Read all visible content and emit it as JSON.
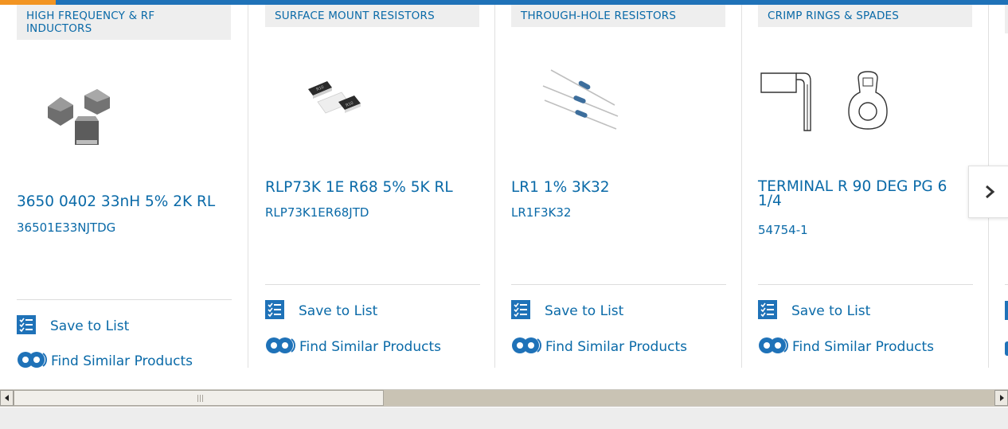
{
  "colors": {
    "accent_blue": "#1f72b8",
    "accent_orange": "#f29422",
    "link": "#0a6aa8",
    "category_bg": "#eeeeee"
  },
  "carousel": {
    "products": [
      {
        "category": "HIGH FREQUENCY & RF INDUCTORS",
        "name": "3650 0402 33nH 5% 2K RL",
        "part_number": "36501E33NJTDG",
        "image_icon": "inductor-chips-image",
        "save_label": "Save to List",
        "find_label": "Find Similar Products"
      },
      {
        "category": "SURFACE MOUNT RESISTORS",
        "name": "RLP73K 1E R68 5% 5K RL",
        "part_number": "RLP73K1ER68JTD",
        "image_icon": "smd-resistor-image",
        "chip_text": "R10",
        "save_label": "Save to List",
        "find_label": "Find Similar Products"
      },
      {
        "category": "THROUGH-HOLE RESISTORS",
        "name": "LR1 1% 3K32",
        "part_number": "LR1F3K32",
        "image_icon": "axial-resistor-image",
        "save_label": "Save to List",
        "find_label": "Find Similar Products"
      },
      {
        "category": "CRIMP RINGS & SPADES",
        "name": "TERMINAL R 90 DEG PG 6 1/4",
        "part_number": "54754-1",
        "image_icon": "ring-terminal-image",
        "save_label": "Save to List",
        "find_label": "Find Similar Products"
      }
    ],
    "next_icon": "chevron-right-icon"
  },
  "scrollbar": {
    "left_icon": "arrow-left-icon",
    "right_icon": "arrow-right-icon"
  }
}
